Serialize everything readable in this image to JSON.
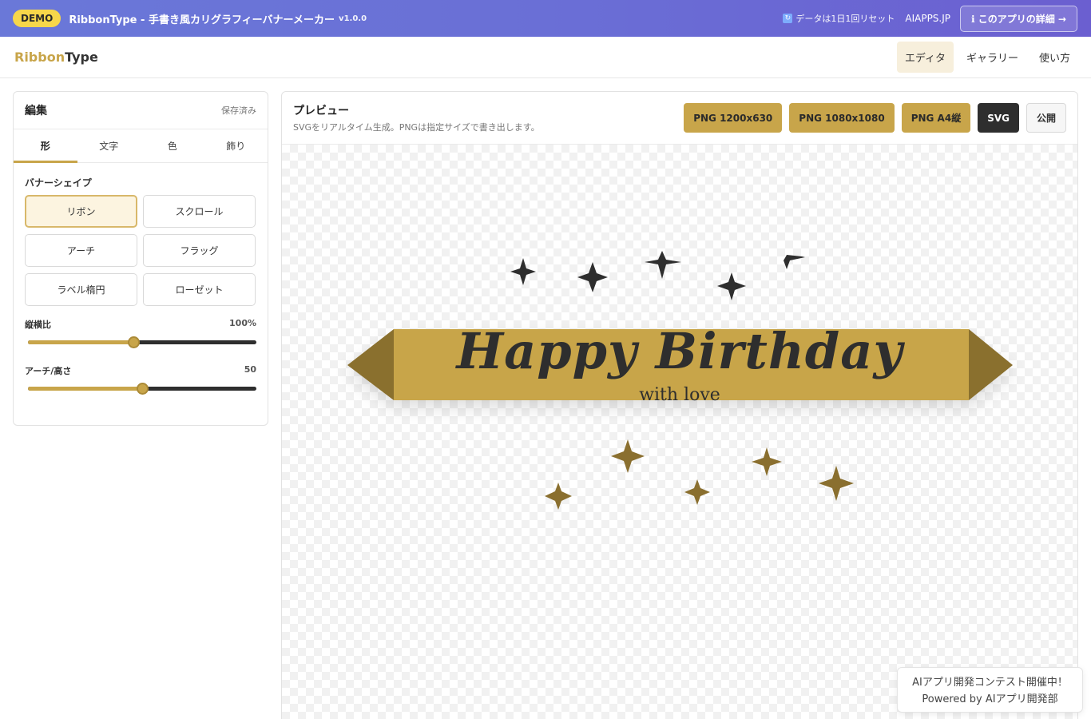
{
  "demo_bar": {
    "badge": "DEMO",
    "title": "RibbonType - 手書き風カリグラフィーバナーメーカー",
    "version": "v1.0.0",
    "reset_note": "データは1日1回リセット",
    "aiapps_link": "AIAPPS.JP",
    "detail_button": "ℹ このアプリの詳細 →"
  },
  "header": {
    "logo_part1": "Ribbon",
    "logo_part2": "Type",
    "nav": [
      "エディタ",
      "ギャラリー",
      "使い方"
    ]
  },
  "editor": {
    "title": "編集",
    "status": "保存済み",
    "tabs": [
      "形",
      "文字",
      "色",
      "飾り"
    ],
    "shape_label": "バナーシェイプ",
    "shapes": [
      "リボン",
      "スクロール",
      "アーチ",
      "フラッグ",
      "ラベル楕円",
      "ローゼット"
    ],
    "selected_shape": "リボン",
    "sliders": [
      {
        "label": "縦横比",
        "value": "100%",
        "fraction": 0.46
      },
      {
        "label": "アーチ/高さ",
        "value": "50",
        "fraction": 0.5
      }
    ]
  },
  "preview": {
    "title": "プレビュー",
    "subtitle": "SVGをリアルタイム生成。PNGは指定サイズで書き出します。",
    "exports": [
      "PNG 1200x630",
      "PNG 1080x1080",
      "PNG A4縦",
      "SVG",
      "公開"
    ],
    "banner_main_text": "Happy Birthday",
    "banner_sub_text": "with love"
  },
  "colors": {
    "accent": "#c8a54a",
    "accent_dark": "#8a6f2f",
    "ink": "#2e2e2e",
    "demo_gradient": "#6a6fd6"
  },
  "contest": {
    "line1": "AIアプリ開発コンテスト開催中！",
    "line2": "Powered by AIアプリ開発部"
  }
}
